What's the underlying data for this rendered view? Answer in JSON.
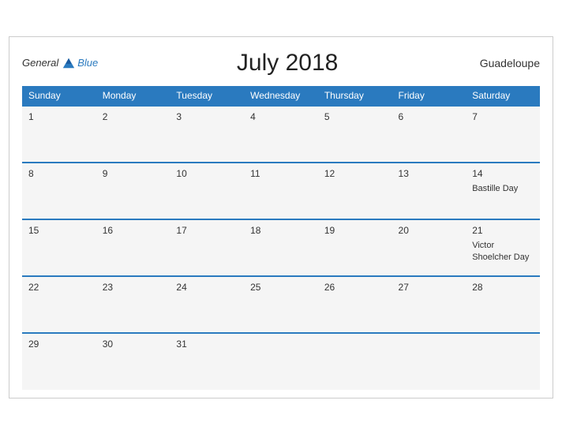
{
  "header": {
    "title": "July 2018",
    "region": "Guadeloupe",
    "logo": {
      "general": "General",
      "blue": "Blue"
    }
  },
  "weekdays": [
    "Sunday",
    "Monday",
    "Tuesday",
    "Wednesday",
    "Thursday",
    "Friday",
    "Saturday"
  ],
  "weeks": [
    [
      {
        "day": "1",
        "event": ""
      },
      {
        "day": "2",
        "event": ""
      },
      {
        "day": "3",
        "event": ""
      },
      {
        "day": "4",
        "event": ""
      },
      {
        "day": "5",
        "event": ""
      },
      {
        "day": "6",
        "event": ""
      },
      {
        "day": "7",
        "event": ""
      }
    ],
    [
      {
        "day": "8",
        "event": ""
      },
      {
        "day": "9",
        "event": ""
      },
      {
        "day": "10",
        "event": ""
      },
      {
        "day": "11",
        "event": ""
      },
      {
        "day": "12",
        "event": ""
      },
      {
        "day": "13",
        "event": ""
      },
      {
        "day": "14",
        "event": "Bastille Day"
      }
    ],
    [
      {
        "day": "15",
        "event": ""
      },
      {
        "day": "16",
        "event": ""
      },
      {
        "day": "17",
        "event": ""
      },
      {
        "day": "18",
        "event": ""
      },
      {
        "day": "19",
        "event": ""
      },
      {
        "day": "20",
        "event": ""
      },
      {
        "day": "21",
        "event": "Victor Shoelcher Day"
      }
    ],
    [
      {
        "day": "22",
        "event": ""
      },
      {
        "day": "23",
        "event": ""
      },
      {
        "day": "24",
        "event": ""
      },
      {
        "day": "25",
        "event": ""
      },
      {
        "day": "26",
        "event": ""
      },
      {
        "day": "27",
        "event": ""
      },
      {
        "day": "28",
        "event": ""
      }
    ],
    [
      {
        "day": "29",
        "event": ""
      },
      {
        "day": "30",
        "event": ""
      },
      {
        "day": "31",
        "event": ""
      },
      {
        "day": "",
        "event": ""
      },
      {
        "day": "",
        "event": ""
      },
      {
        "day": "",
        "event": ""
      },
      {
        "day": "",
        "event": ""
      }
    ]
  ]
}
